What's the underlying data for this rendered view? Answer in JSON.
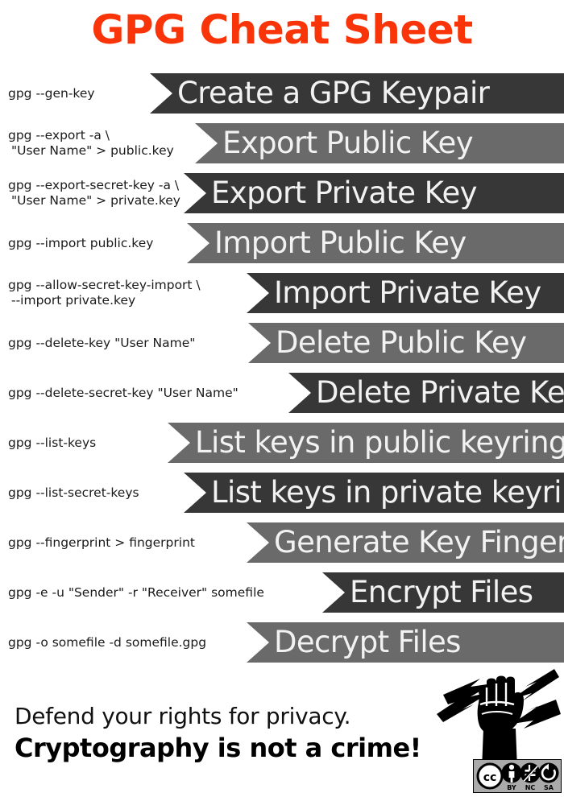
{
  "title": "GPG Cheat Sheet",
  "title_color": "#fa3409",
  "colors": {
    "band_dark": "#373737",
    "band_light": "#6a6a6a",
    "band_text": "#f2f2f2",
    "command_text": "#1a1a1a",
    "background": "#ffffff"
  },
  "rows": [
    {
      "command_line1": "gpg --gen-key",
      "command_line2": "",
      "label": "Create a GPG Keypair",
      "shade": "dark"
    },
    {
      "command_line1": "gpg --export -a \\",
      "command_line2": "\"User Name\" > public.key",
      "label": "Export Public Key",
      "shade": "light"
    },
    {
      "command_line1": "gpg --export-secret-key -a \\",
      "command_line2": "\"User Name\" > private.key",
      "label": "Export Private Key",
      "shade": "dark"
    },
    {
      "command_line1": "gpg --import public.key",
      "command_line2": "",
      "label": "Import Public Key",
      "shade": "light"
    },
    {
      "command_line1": "gpg --allow-secret-key-import \\",
      "command_line2": "--import private.key",
      "label": "Import Private Key",
      "shade": "dark"
    },
    {
      "command_line1": "gpg --delete-key \"User Name\"",
      "command_line2": "",
      "label": "Delete Public Key",
      "shade": "light"
    },
    {
      "command_line1": "gpg --delete-secret-key \"User Name\"",
      "command_line2": "",
      "label": "Delete Private Key",
      "shade": "dark"
    },
    {
      "command_line1": "gpg --list-keys",
      "command_line2": "",
      "label": "List keys in public keyring",
      "shade": "light"
    },
    {
      "command_line1": "gpg --list-secret-keys",
      "command_line2": "",
      "label": "List keys in private keyring",
      "shade": "dark"
    },
    {
      "command_line1": "gpg --fingerprint > fingerprint",
      "command_line2": "",
      "label": "Generate Key Fingerprint",
      "shade": "light"
    },
    {
      "command_line1": "gpg -e -u \"Sender\" -r \"Receiver\" somefile",
      "command_line2": "",
      "label": "Encrypt Files",
      "shade": "dark"
    },
    {
      "command_line1": "gpg -o somefile -d somefile.gpg",
      "command_line2": "",
      "label": "Decrypt Files",
      "shade": "light"
    }
  ],
  "footer": {
    "line1": "Defend your rights for privacy.",
    "line2": "Cryptography is not a crime!",
    "fist_icon_name": "raised-fist-with-lightning-icon",
    "license": {
      "badge_name": "creative-commons-by-nc-sa-badge",
      "cc": "cc",
      "terms": [
        "BY",
        "NC",
        "SA"
      ]
    }
  }
}
